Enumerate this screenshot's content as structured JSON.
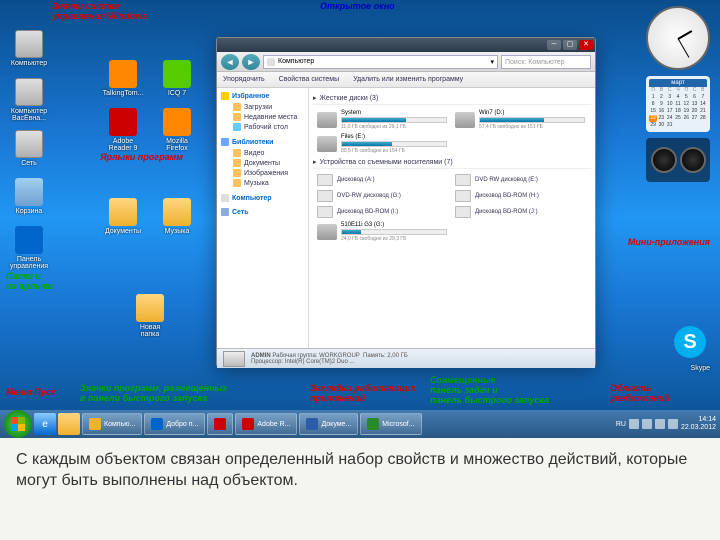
{
  "labels": {
    "sys_icons": "Значки систем\nуправления Windows",
    "open_window": "Открытое окно",
    "shortcuts": "Ярлыки программ",
    "folders": "Папки и\nих ярлыки",
    "start_menu": "Меню Пуск",
    "quick_launch": "Значки программ, размещенных\nв панели быстрого запуска",
    "tabs": "Закладки работающих\nприложений",
    "taskbar_combo": "Совмещенные\nпанель задач и\nпанель быстрого запуска",
    "notif": "Область\nуведомлений",
    "mini_apps": "Мини-приложения"
  },
  "desktop_icons": {
    "computer": "Компьютер",
    "mycomp": "Компьютер\nВасЁвна...",
    "network": "Сеть",
    "recycle": "Корзина",
    "panel": "Панель\nуправления",
    "talking": "TalkingTom...",
    "adobe": "Adobe\nReader 9",
    "icq": "ICQ 7",
    "firefox": "Mozilla\nFirefox",
    "documents": "Документы",
    "music": "Музыка",
    "newfolder": "Новая\nпапка"
  },
  "explorer": {
    "path_label": "Компьютер",
    "search_ph": "Поиск: Компьютер",
    "toolbar": {
      "organize": "Упорядочить",
      "props": "Свойства системы",
      "uninstall": "Удалить или изменить программу"
    },
    "sidebar": {
      "favorites": "Избранное",
      "downloads": "Загрузки",
      "recent": "Недавние места",
      "desktop": "Рабочий стол",
      "libraries": "Библиотеки",
      "video": "Видео",
      "docs": "Документы",
      "pics": "Изображения",
      "music": "Музыка",
      "computer": "Компьютер",
      "network": "Сеть"
    },
    "sections": {
      "drives": "Жесткие диски (3)",
      "devices": "Устройства со съемными носителями (7)"
    },
    "drives": [
      {
        "name": "System",
        "free": "11,0 ГБ свободно из 29,1 ГБ",
        "fill": 62
      },
      {
        "name": "Win7 (D:)",
        "free": "57,4 ГБ свободно из 151 ГБ",
        "fill": 62
      },
      {
        "name": "Files (E:)",
        "free": "80,5 ГБ свободно из 154 ГБ",
        "fill": 48
      },
      {
        "name": "510E11i G3 (G:)",
        "free": "24,0 ГБ свободно из 29,3 ГБ",
        "fill": 18
      }
    ],
    "devices": [
      "Дисковод (A:)",
      "DVD RW дисковод (E:)",
      "DVD-RW дисковод (G:)",
      "Дисковод BD-ROM (H:)",
      "Дисковод BD-ROM (I:)",
      "Дисковод BD-ROM (J:)"
    ],
    "status": {
      "user": "ADMIN",
      "wg_label": "Рабочая группа:",
      "wg": "WORKGROUP",
      "cpu_label": "Процессор:",
      "cpu": "Intel(R) Core(TM)2 Duo ...",
      "mem_label": "Память:",
      "mem": "2,00 ГБ"
    }
  },
  "calendar": {
    "month": "март",
    "days": [
      "П",
      "В",
      "С",
      "Ч",
      "П",
      "С",
      "В"
    ],
    "today": 22
  },
  "taskbar": {
    "buttons": [
      {
        "label": "Компью...",
        "color": "#f0b030"
      },
      {
        "label": "Добро п...",
        "color": "#06c"
      },
      {
        "label": "",
        "color": "#c00"
      },
      {
        "label": "Adobe R...",
        "color": "#c00"
      },
      {
        "label": "Докуме...",
        "color": "#2a5caa"
      },
      {
        "label": "Microsof...",
        "color": "#2a8a2a"
      }
    ],
    "lang": "RU",
    "time": "14:14",
    "date": "22.03.2012"
  },
  "skype": "Skype",
  "caption": "С каждым объектом связан определенный набор свойств и множество действий, которые могут быть выполнены над объектом."
}
